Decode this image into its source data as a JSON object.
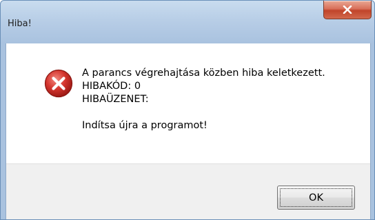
{
  "window": {
    "title": "Hiba!",
    "close_icon": "close-icon"
  },
  "dialog": {
    "icon": "error-icon",
    "message_lines": [
      "A parancs végrehajtása közben hiba keletkezett.",
      "HIBAKÓD: 0",
      "HIBAÜZENET:",
      "",
      "Indítsa újra a programot!"
    ]
  },
  "buttons": {
    "ok_label": "OK"
  },
  "colors": {
    "close_button": "#c8503a",
    "error_icon": "#c8302c",
    "frame_accent": "#b7cde6"
  }
}
